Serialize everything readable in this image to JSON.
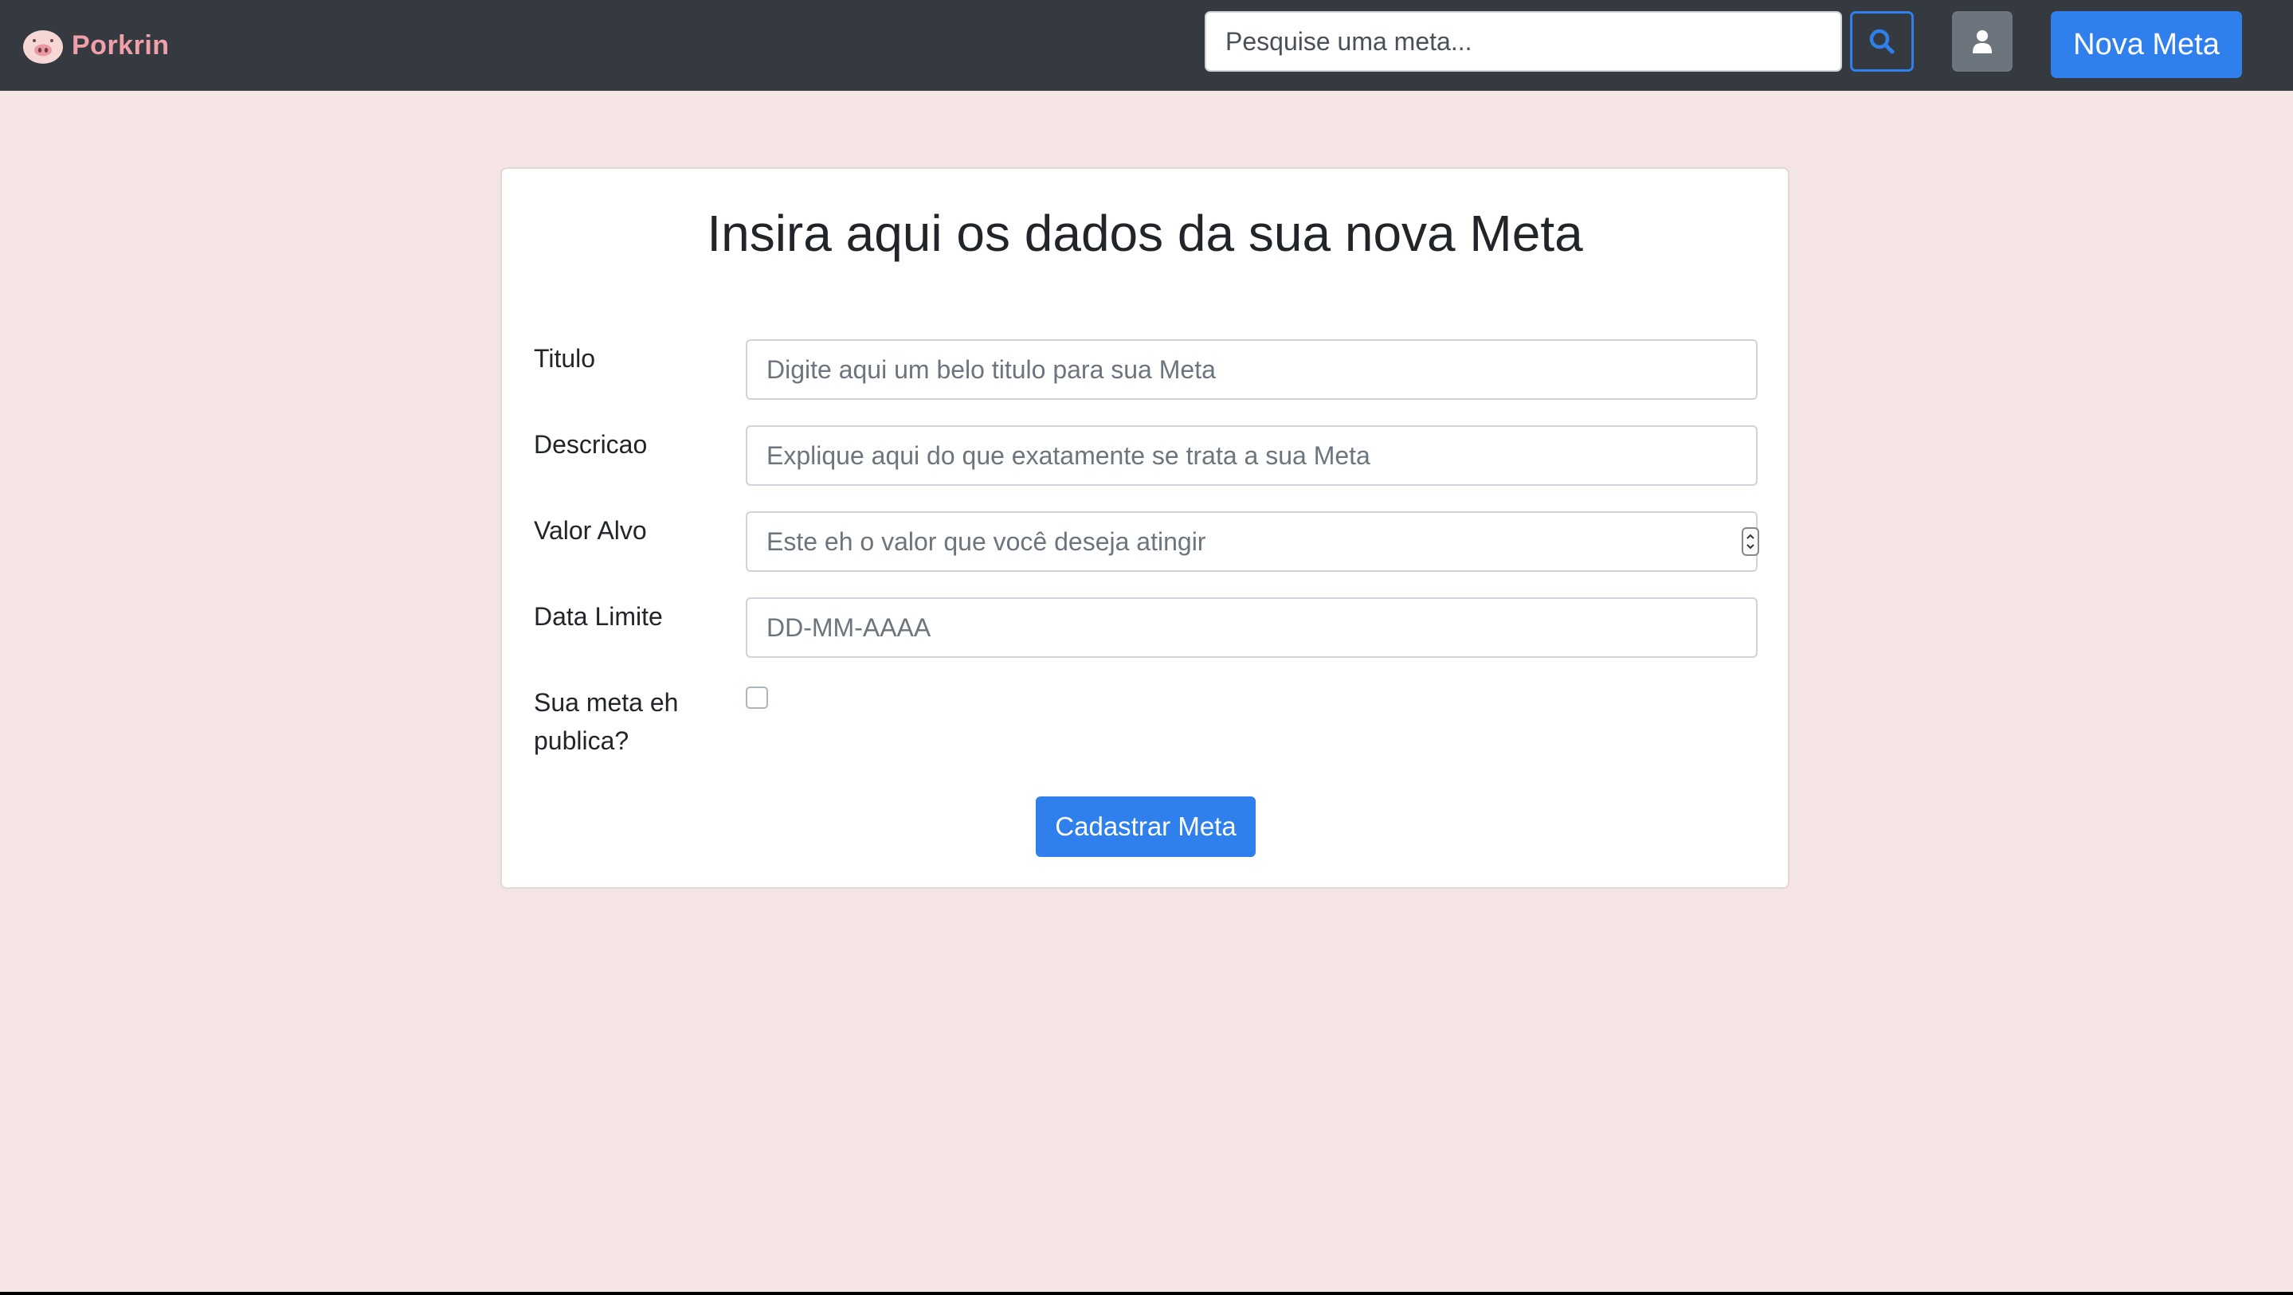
{
  "navbar": {
    "brand": "Porkrin",
    "search_placeholder": "Pesquise uma meta...",
    "new_goal_label": "Nova Meta",
    "icons": {
      "logo": "pig-face-icon",
      "search": "search-icon",
      "user": "user-icon"
    }
  },
  "form": {
    "title": "Insira aqui os dados da sua nova Meta",
    "fields": {
      "titulo": {
        "label": "Titulo",
        "placeholder": "Digite aqui um belo titulo para sua Meta"
      },
      "descricao": {
        "label": "Descricao",
        "placeholder": "Explique aqui do que exatamente se trata a sua Meta"
      },
      "valor_alvo": {
        "label": "Valor Alvo",
        "placeholder": "Este eh o valor que você deseja atingir"
      },
      "data_limite": {
        "label": "Data Limite",
        "placeholder": "DD-MM-AAAA"
      },
      "publica": {
        "label_line1": "Sua meta eh",
        "label_line2": "publica?",
        "checked": false
      }
    },
    "submit_label": "Cadastrar Meta"
  },
  "colors": {
    "navbar_bg": "#343a40",
    "page_bg": "#f5e4e4",
    "primary": "#2f80ed",
    "secondary": "#6c757d",
    "brand": "#f0a0a8"
  }
}
